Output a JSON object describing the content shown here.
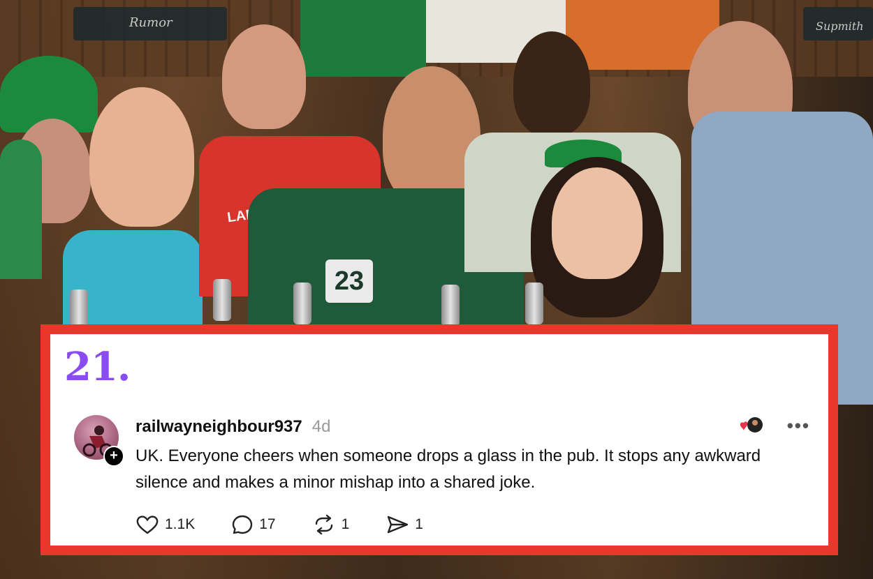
{
  "background": {
    "signs": [
      "Rumor",
      "Supmith"
    ],
    "jersey_number": "23",
    "shirt_text": "LADS C TOUR"
  },
  "card": {
    "number": "21.",
    "border_color": "#e8372b",
    "number_color": "#8a4cf0"
  },
  "post": {
    "username": "railwayneighbour937",
    "timestamp": "4d",
    "body": "UK. Everyone cheers when someone drops a glass in the pub. It stops any awkward silence and makes a minor mishap into a shared joke.",
    "avatar_icon": "avatar-image",
    "follow_badge": "+",
    "more_label": "•••",
    "actions": {
      "likes": "1.1K",
      "replies": "17",
      "reposts": "1",
      "shares": "1"
    }
  }
}
